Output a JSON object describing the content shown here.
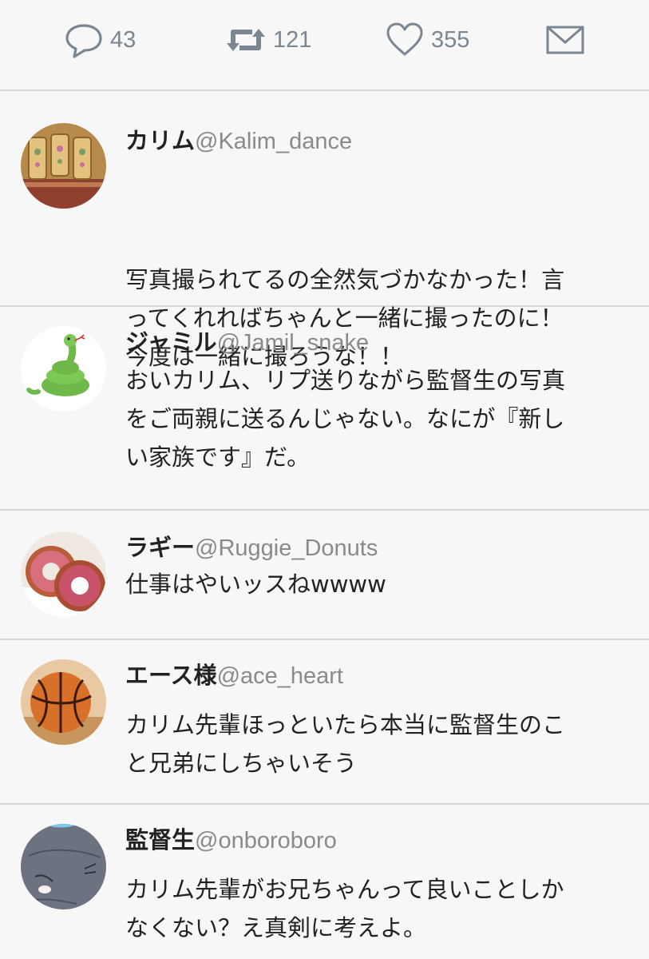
{
  "actions": {
    "reply_count": "43",
    "retweet_count": "121",
    "like_count": "355",
    "reply_icon": "speech-bubble-icon",
    "retweet_icon": "retweet-icon",
    "like_icon": "heart-icon",
    "dm_icon": "envelope-icon"
  },
  "replies": [
    {
      "name": "カリム",
      "handle": "@Kalim_dance",
      "text": "写真撮られてるの全然気づかなかった！言\nってくれればちゃんと一緒に撮ったのに！\n今度は一緒に撮ろうな！！"
    },
    {
      "name": "ジャミル",
      "handle": "@Jamil_snake",
      "text": "おいカリム、リプ送りながら監督生の写真\nをご両親に送るんじゃない。なにが『新し\nい家族です』だ。"
    },
    {
      "name": "ラギー",
      "handle": "@Ruggie_Donuts",
      "text": "仕事はやいッスねwwww"
    },
    {
      "name": "エース様",
      "handle": "@ace_heart",
      "text": "カリム先輩ほっといたら本当に監督生のこ\nと兄弟にしちゃいそう"
    },
    {
      "name": "監督生",
      "handle": "@onboroboro",
      "text": "カリム先輩がお兄ちゃんって良いことしか\nなくない？え真剣に考えよ。"
    }
  ],
  "colors": {
    "icon_gray": "#7a8692",
    "divider": "#d8d8d8",
    "handle_gray": "#8a8a8a"
  }
}
